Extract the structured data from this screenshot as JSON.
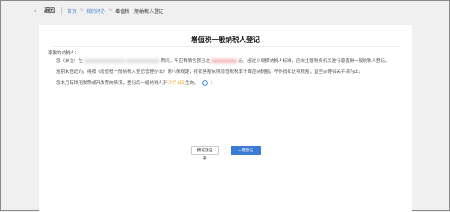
{
  "topbar": {
    "back_label": "返回",
    "breadcrumbs": [
      "首页",
      "我的待办",
      "增值税一般纳税人登记"
    ],
    "separator": ">"
  },
  "document": {
    "title": "增值税一般纳税人登记",
    "greeting": "尊敬的纳税人：",
    "para1_a": "您（单位）在",
    "para1_b": "期间，年应税销售额已达",
    "para1_c": "元，超过小规模纳税人标准，应向主管税务机关进行增值税一般纳税人登记。",
    "para2": "逾期未登记的，将按《增值税一般纳税人登记管理办法》第八条规定，按销售额依照增值税税率计算应纳税额，不得抵扣进项税额，直至办理相关手续为止。",
    "para3_a": "您本月有领用发票或开发票的情况，登记后一般纳税人于",
    "para3_date": "次月1日",
    "para3_b": "生效。",
    "info_icon_glyph": "i"
  },
  "actions": {
    "secondary_label": "预览登记表",
    "primary_label": "一键登记"
  },
  "colors": {
    "accent": "#3a7bd5",
    "link": "#5b8fd6",
    "highlight": "#f5a623"
  }
}
